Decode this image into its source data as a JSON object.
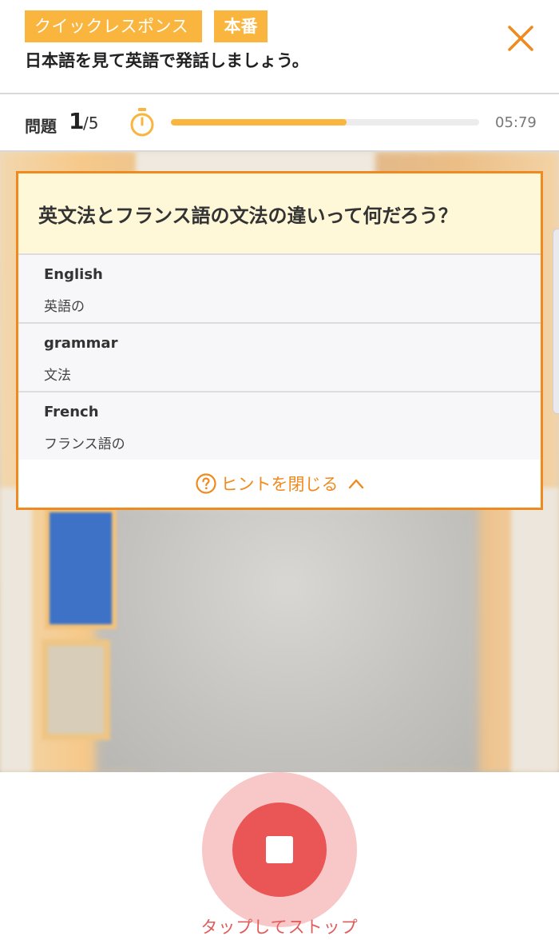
{
  "header": {
    "mode_tag": "クイックレスポンス",
    "stage_tag": "本番",
    "instruction": "日本語を見て英語で発話しましょう。",
    "close_icon": "close-icon"
  },
  "progress": {
    "label": "問題",
    "current": "1",
    "total_text": "/5",
    "timer_icon": "stopwatch-icon",
    "time_display": "05:79",
    "fill_fraction": 0.57
  },
  "hint": {
    "question": "英文法とフランス語の文法の違いって何だろう？",
    "items": [
      {
        "word": "English",
        "meaning": "英語の"
      },
      {
        "word": "grammar",
        "meaning": "文法"
      },
      {
        "word": "French",
        "meaning": "フランス語の"
      }
    ],
    "close_label": "ヒントを閉じる"
  },
  "record": {
    "stop_label": "タップしてストップ"
  },
  "colors": {
    "accent_orange": "#f08a1e",
    "tag_yellow": "#f9b53e",
    "record_red": "#ea5556",
    "record_halo": "#f8c8c8"
  }
}
